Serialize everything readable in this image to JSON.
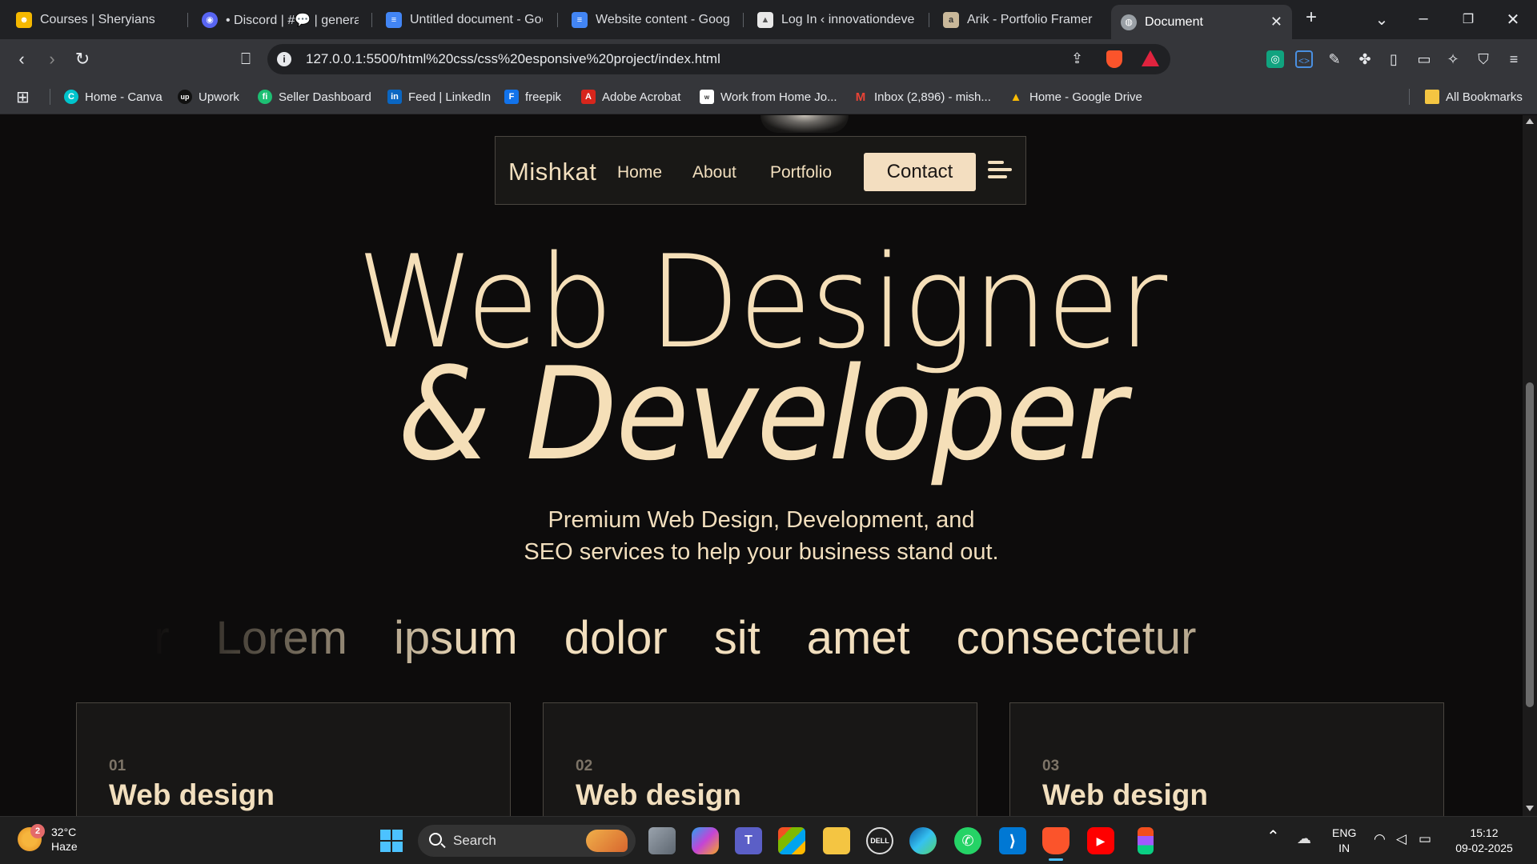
{
  "browser": {
    "tabs": [
      {
        "title": "Courses | Sheryians",
        "color": "#f5b800"
      },
      {
        "title": "• Discord | #💬 | general",
        "color": "#5865f2"
      },
      {
        "title": "Untitled document - Goo",
        "color": "#4285f4"
      },
      {
        "title": "Website content - Google",
        "color": "#4285f4"
      },
      {
        "title": "Log In ‹ innovationdevelo",
        "color": "#e8e8e8"
      },
      {
        "title": "Arik - Portfolio Framer Te",
        "color": "#c9b89a"
      },
      {
        "title": "Document",
        "color": "#9aa0a6",
        "active": true
      }
    ],
    "url": "127.0.0.1:5500/html%20css/css%20esponsive%20project/index.html",
    "bookmarks": [
      {
        "label": "Home - Canva",
        "color": "#00c4cc",
        "icon": "C"
      },
      {
        "label": "Upwork",
        "color": "#222",
        "icon": "up"
      },
      {
        "label": "Seller Dashboard",
        "color": "#1dbf73",
        "icon": "fi"
      },
      {
        "label": "Feed | LinkedIn",
        "color": "#0a66c2",
        "icon": "in"
      },
      {
        "label": "freepik",
        "color": "#1273eb",
        "icon": "F"
      },
      {
        "label": "Adobe Acrobat",
        "color": "#d7261c",
        "icon": "A"
      },
      {
        "label": "Work from Home Jo...",
        "color": "#ffffff",
        "icon": "w"
      },
      {
        "label": "Inbox (2,896) - mish...",
        "color": "#ea4335",
        "icon": "M"
      },
      {
        "label": "Home - Google Drive",
        "color": "#fbbc04",
        "icon": "▲"
      }
    ],
    "all_bookmarks": "All Bookmarks"
  },
  "page": {
    "brand": "Mishkat",
    "nav": [
      "Home",
      "About",
      "Portfolio"
    ],
    "contact": "Contact",
    "hero_line1": "Web Designer",
    "hero_line2": "& Developer",
    "subtitle_line1": "Premium Web Design, Development, and",
    "subtitle_line2": "SEO services to help your business stand out.",
    "marquee": [
      "ur",
      "Lorem",
      "ipsum",
      "dolor",
      "sit",
      "amet",
      "consectetur"
    ],
    "cards": [
      {
        "num": "01",
        "title": "Web design"
      },
      {
        "num": "02",
        "title": "Web design"
      },
      {
        "num": "03",
        "title": "Web design"
      }
    ],
    "accent": "#f3dec0",
    "background": "#0d0c0c"
  },
  "taskbar": {
    "temp": "32°C",
    "weather": "Haze",
    "weather_badge": "2",
    "search": "Search",
    "lang_line1": "ENG",
    "lang_line2": "IN",
    "time": "15:12",
    "date": "09-02-2025"
  }
}
